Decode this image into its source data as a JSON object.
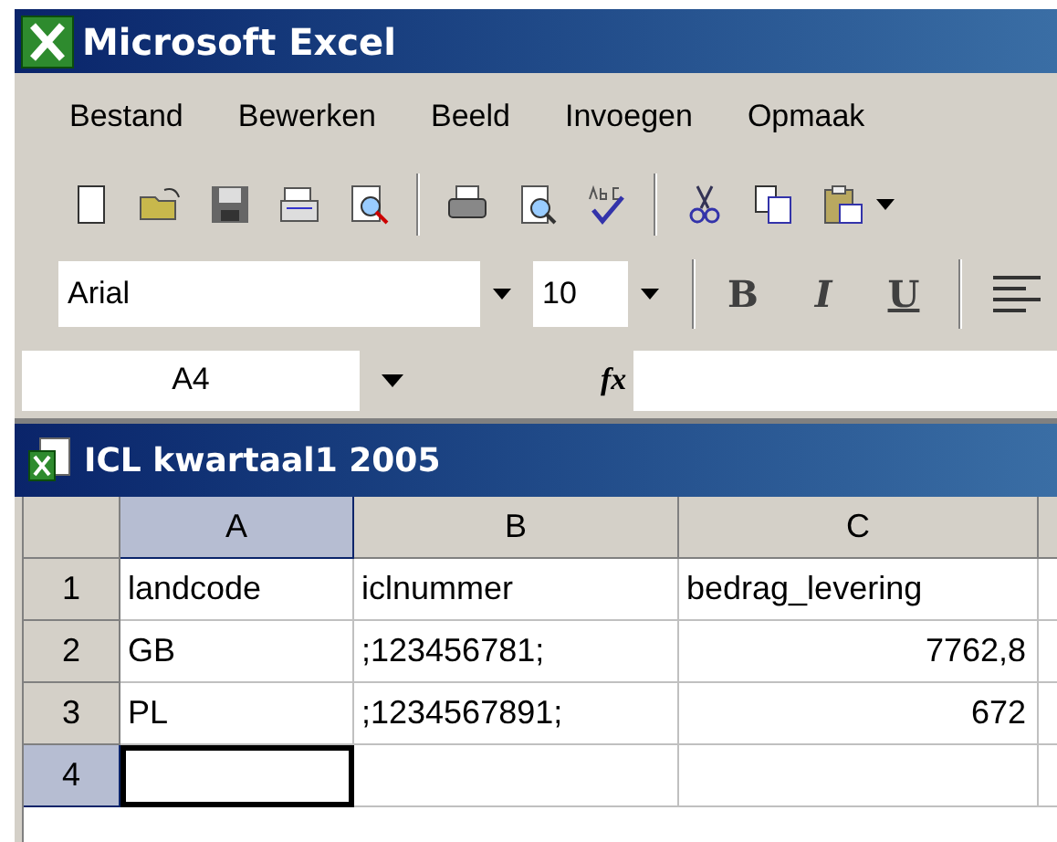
{
  "window": {
    "title": "Microsoft Excel"
  },
  "menu": [
    {
      "label": "Bestand"
    },
    {
      "label": "Bewerken"
    },
    {
      "label": "Beeld"
    },
    {
      "label": "Invoegen"
    },
    {
      "label": "Opmaak"
    }
  ],
  "format_bar": {
    "font": "Arial",
    "size": "10",
    "styles": [
      {
        "label": "B",
        "kind": "bold"
      },
      {
        "label": "I",
        "kind": "italic"
      },
      {
        "label": "U",
        "kind": "underline"
      }
    ]
  },
  "formula_bar": {
    "name_box": "A4",
    "function_label": "fx"
  },
  "workbook": {
    "title": "ICL kwartaal1 2005"
  },
  "sheet": {
    "columns": [
      {
        "label": "A",
        "selected": true
      },
      {
        "label": "B",
        "selected": false
      },
      {
        "label": "C",
        "selected": false
      }
    ],
    "rows": [
      {
        "header": "1",
        "selected": false,
        "cells": [
          {
            "value": "landcode",
            "kind": "text",
            "selected": false
          },
          {
            "value": "iclnummer",
            "kind": "text",
            "selected": false
          },
          {
            "value": "bedrag_levering",
            "kind": "text",
            "selected": false
          }
        ]
      },
      {
        "header": "2",
        "selected": false,
        "cells": [
          {
            "value": "GB",
            "kind": "text",
            "selected": false
          },
          {
            "value": ";123456781;",
            "kind": "text",
            "selected": false
          },
          {
            "value": "7762,8",
            "kind": "number",
            "selected": false
          }
        ]
      },
      {
        "header": "3",
        "selected": false,
        "cells": [
          {
            "value": "PL",
            "kind": "text",
            "selected": false
          },
          {
            "value": ";1234567891;",
            "kind": "text",
            "selected": false
          },
          {
            "value": "672",
            "kind": "number",
            "selected": false
          }
        ]
      },
      {
        "header": "4",
        "selected": true,
        "cells": [
          {
            "kind": "text",
            "selected": true
          },
          {
            "kind": "text",
            "selected": false
          },
          {
            "kind": "text",
            "selected": false
          }
        ]
      }
    ]
  }
}
